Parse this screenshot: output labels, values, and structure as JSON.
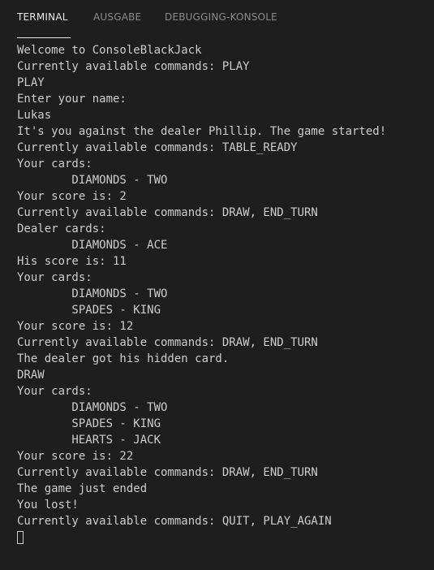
{
  "tabs": [
    {
      "label": "TERMINAL",
      "active": true
    },
    {
      "label": "AUSGABE",
      "active": false
    },
    {
      "label": "DEBUGGING-KONSOLE",
      "active": false
    }
  ],
  "terminal": {
    "lines": [
      "Welcome to ConsoleBlackJack",
      "Currently available commands: PLAY",
      "PLAY",
      "Enter your name:",
      "Lukas",
      "It's you against the dealer Phillip. The game started!",
      "Currently available commands: TABLE_READY",
      "Your cards:",
      "        DIAMONDS - TWO",
      "Your score is: 2",
      "Currently available commands: DRAW, END_TURN",
      "Dealer cards:",
      "        DIAMONDS - ACE",
      "His score is: 11",
      "Your cards:",
      "        DIAMONDS - TWO",
      "        SPADES - KING",
      "Your score is: 12",
      "Currently available commands: DRAW, END_TURN",
      "The dealer got his hidden card.",
      "DRAW",
      "Your cards:",
      "        DIAMONDS - TWO",
      "        SPADES - KING",
      "        HEARTS - JACK",
      "Your score is: 22",
      "Currently available commands: DRAW, END_TURN",
      "The game just ended",
      "You lost!",
      "Currently available commands: QUIT, PLAY_AGAIN"
    ]
  },
  "colors": {
    "background": "#1e1e1e",
    "text": "#cccccc",
    "tab_active": "#e7e7e7",
    "tab_inactive": "#8b8b8b"
  }
}
